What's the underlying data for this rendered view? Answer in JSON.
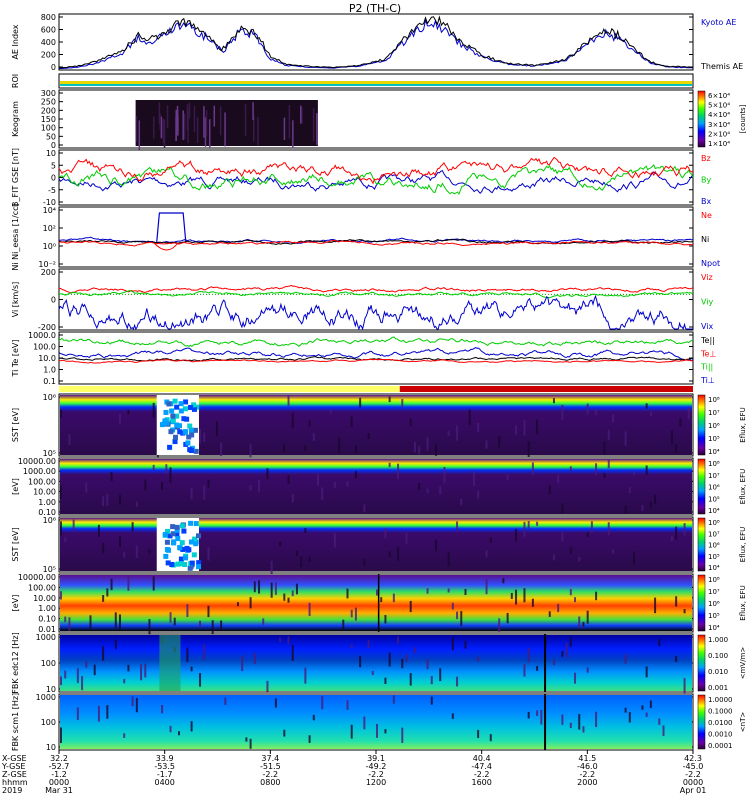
{
  "chart_data": {
    "type": "line",
    "title": "P2 (TH-C)",
    "panels": [
      {
        "key": "ae",
        "ylabel": "AE Index",
        "yticks": [
          "0",
          "200",
          "400",
          "600",
          "800"
        ],
        "ylim": [
          0,
          850
        ],
        "legend": [
          {
            "name": "Kyoto AE",
            "color": "#0000cc"
          },
          {
            "name": "Themis AE",
            "color": "#000000"
          }
        ],
        "series": [
          {
            "name": "Kyoto AE",
            "color": "#0000cc",
            "x": [
              0,
              0.7,
              1.5,
              2.4,
              3.0,
              3.4,
              4.0,
              4.6,
              5.4,
              6.2,
              6.8,
              7.4,
              8.0,
              8.6,
              9.0,
              9.6,
              10.4,
              11.4,
              12.4,
              12.8,
              13.4,
              14.0,
              14.6,
              15.2,
              16.0,
              17.0,
              18.0,
              19.2,
              20.0,
              20.6,
              21.2,
              21.8,
              22.4,
              23.0,
              24.0
            ],
            "y": [
              20,
              40,
              110,
              260,
              480,
              430,
              520,
              700,
              550,
              280,
              560,
              540,
              170,
              70,
              55,
              40,
              30,
              60,
              150,
              330,
              540,
              740,
              620,
              400,
              200,
              90,
              60,
              140,
              380,
              560,
              480,
              280,
              110,
              50,
              30
            ]
          },
          {
            "name": "Themis AE",
            "color": "#000000",
            "x": [
              0,
              0.7,
              1.5,
              2.4,
              3.0,
              3.4,
              4.0,
              4.6,
              5.4,
              6.2,
              6.8,
              7.4,
              8.0,
              8.6,
              9.0,
              9.6,
              10.4,
              11.4,
              12.4,
              12.8,
              13.4,
              14.0,
              14.6,
              15.2,
              16.0,
              17.0,
              18.0,
              19.2,
              20.0,
              20.6,
              21.2,
              21.8,
              22.4,
              23.0,
              24.0
            ],
            "y": [
              30,
              60,
              140,
              300,
              520,
              460,
              560,
              780,
              590,
              310,
              590,
              600,
              200,
              90,
              70,
              50,
              40,
              70,
              170,
              360,
              580,
              800,
              680,
              440,
              220,
              100,
              70,
              160,
              420,
              600,
              520,
              300,
              120,
              60,
              40
            ]
          }
        ]
      },
      {
        "key": "roi",
        "ylabel": "ROI"
      },
      {
        "key": "keogram",
        "ylabel": "Keogram",
        "yticks": [
          "0",
          "50",
          "100",
          "150",
          "200",
          "250",
          "300"
        ],
        "ylim": [
          0,
          300
        ],
        "colorbar": {
          "label": "[counts]",
          "ticks": [
            "1×10⁴",
            "2×10⁴",
            "3×10⁴",
            "4×10⁴",
            "5×10⁴",
            "6×10⁴"
          ]
        }
      },
      {
        "key": "bfield",
        "ylabel": "B_FIT GSE [nT]",
        "yticks": [
          "-10",
          "-5",
          "0",
          "5",
          "10"
        ],
        "ylim": [
          -10,
          10
        ],
        "legend": [
          {
            "name": "Bz",
            "color": "#ff0000"
          },
          {
            "name": "By",
            "color": "#00cc00"
          },
          {
            "name": "Bx",
            "color": "#0000cc"
          }
        ]
      },
      {
        "key": "density",
        "ylabel": "Ni Ni_eesa [1/cc]",
        "yticks": [
          "10⁻²",
          "10⁰",
          "10²",
          "10⁴"
        ],
        "legend": [
          {
            "name": "Ne",
            "color": "#ff0000"
          },
          {
            "name": "Ni",
            "color": "#000000"
          },
          {
            "name": "Npot",
            "color": "#0000cc"
          }
        ]
      },
      {
        "key": "velocity",
        "ylabel": "Vi [km/s]",
        "yticks": [
          "-200",
          "0",
          "200"
        ],
        "ylim": [
          -350,
          250
        ],
        "legend": [
          {
            "name": "Viz",
            "color": "#ff0000"
          },
          {
            "name": "Viy",
            "color": "#00cc00"
          },
          {
            "name": "Vix",
            "color": "#0000cc"
          }
        ]
      },
      {
        "key": "temperature",
        "ylabel": "Ti Te [eV]",
        "yticks": [
          "0.1",
          "1.0",
          "10.0",
          "100.0",
          "1000.0"
        ],
        "legend": [
          {
            "name": "Te||",
            "color": "#000000"
          },
          {
            "name": "Te⊥",
            "color": "#ff0000"
          },
          {
            "name": "Ti||",
            "color": "#00cc00"
          },
          {
            "name": "Ti⊥",
            "color": "#0000cc"
          }
        ]
      },
      {
        "key": "sst_ion",
        "ylabel": "SST [eV]",
        "yticks": [
          "10⁵",
          "10⁶"
        ],
        "colorbar": {
          "label": "Eflux, EFU",
          "ticks": [
            "10⁴",
            "10⁵",
            "10⁶",
            "10⁷",
            "10⁸"
          ]
        }
      },
      {
        "key": "esa_ion",
        "ylabel": "[eV]",
        "yticks": [
          "0.10",
          "1.00",
          "10.00",
          "100.00",
          "1000.00",
          "10000.00"
        ],
        "colorbar": {
          "label": "Eflux, EFU",
          "ticks": [
            "10⁴",
            "10⁵",
            "10⁶",
            "10⁷",
            "10⁸"
          ]
        }
      },
      {
        "key": "sst_elec",
        "ylabel": "SST [eV]",
        "yticks": [
          "10⁵",
          "10⁶"
        ],
        "colorbar": {
          "label": "Eflux, EFU",
          "ticks": [
            "10⁴",
            "10⁵",
            "10⁶",
            "10⁷",
            "10⁸"
          ]
        }
      },
      {
        "key": "esa_elec",
        "ylabel": "[eV]",
        "yticks": [
          "0.01",
          "0.10",
          "1.00",
          "10.00",
          "100.00",
          "10000.00"
        ],
        "colorbar": {
          "label": "Eflux, EFU",
          "ticks": [
            "10⁴",
            "10⁵",
            "10⁶",
            "10⁷",
            "10⁸"
          ]
        }
      },
      {
        "key": "fbk_e",
        "ylabel": "FBK edc12 [Hz]",
        "yticks": [
          "10",
          "100",
          "1000"
        ],
        "colorbar": {
          "label": "<mV/m>",
          "ticks": [
            "0.001",
            "0.010",
            "0.100",
            "1.000"
          ]
        }
      },
      {
        "key": "fbk_b",
        "ylabel": "FBK scm1 [Hz]",
        "yticks": [
          "10",
          "100",
          "1000"
        ],
        "colorbar": {
          "label": "<nT>",
          "ticks": [
            "0.0001",
            "0.0010",
            "0.0100",
            "0.1000",
            "1.0000"
          ]
        }
      }
    ],
    "xaxis": {
      "rows": [
        {
          "label": "X-GSE",
          "values": [
            "32.2",
            "33.9",
            "37.4",
            "39.1",
            "40.4",
            "41.5",
            "42.3"
          ]
        },
        {
          "label": "Y-GSE",
          "values": [
            "-52.7",
            "-53.5",
            "-51.5",
            "-49.2",
            "-47.4",
            "-46.0",
            "-45.0"
          ]
        },
        {
          "label": "Z-GSE",
          "values": [
            "-1.2",
            "-1.7",
            "-2.2",
            "-2.2",
            "-2.2",
            "-2.2",
            "-2.2"
          ]
        },
        {
          "label": "hhmm",
          "values": [
            "0000",
            "0400",
            "0800",
            "1200",
            "1600",
            "2000",
            "0000"
          ]
        },
        {
          "label": "2019",
          "values": [
            "Mar 31",
            "",
            "",
            "",
            "",
            "",
            "Apr 01"
          ]
        }
      ],
      "hours": [
        0,
        4,
        8,
        12,
        16,
        20,
        24
      ]
    }
  }
}
